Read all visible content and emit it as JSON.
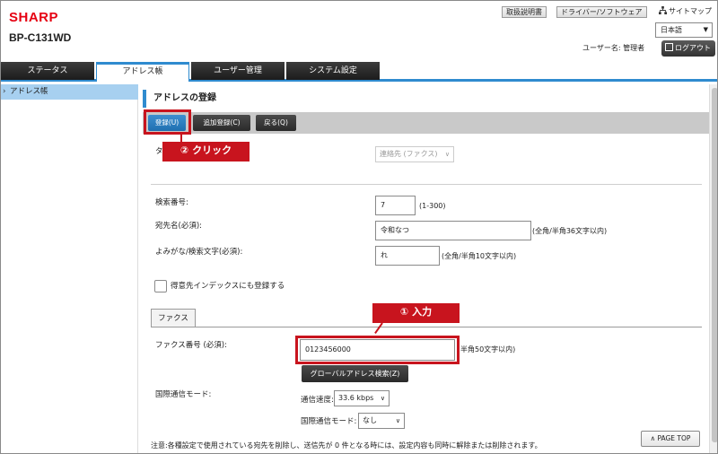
{
  "brand": "SHARP",
  "model": "BP-C131WD",
  "top_links": {
    "manual": "取扱説明書",
    "driver": "ドライバー/ソフトウェア",
    "sitemap": "サイトマップ"
  },
  "language": "日本語",
  "user": {
    "label": "ユーザー名: 管理者",
    "logout": "ログアウト"
  },
  "tabs": [
    "ステータス",
    "アドレス帳",
    "ユーザー管理",
    "システム設定"
  ],
  "active_tab": "アドレス帳",
  "sidebar": {
    "items": [
      {
        "label": "アドレス帳"
      }
    ]
  },
  "page_title": "アドレスの登録",
  "buttons": {
    "register": "登録(U)",
    "add_register": "追加登録(C)",
    "back": "戻る(Q)"
  },
  "callouts": {
    "click": "② クリック",
    "input": "① 入力"
  },
  "type": {
    "label": "タ",
    "value": "連絡先 (ファクス)"
  },
  "form": {
    "search_no": {
      "label": "検索番号:",
      "value": "7",
      "hint": "(1-300)"
    },
    "name": {
      "label": "宛先名(必須):",
      "value": "令和なつ",
      "hint": "(全角/半角36文字以内)"
    },
    "kana": {
      "label": "よみがな/検索文字(必須):",
      "value": "れ",
      "hint": "(全角/半角10文字以内)"
    },
    "index_checkbox": {
      "label": "得意先インデックスにも登録する",
      "checked": false
    }
  },
  "fax_tab": "ファクス",
  "fax": {
    "number": {
      "label": "ファクス番号 (必須):",
      "value": "0123456000",
      "hint": "半角50文字以内)"
    },
    "global_button": "グローバルアドレス検索(Z)",
    "intl_mode_label": "国際通信モード:",
    "speed": {
      "label": "通信速度:",
      "value": "33.6 kbps"
    },
    "intl": {
      "label": "国際通信モード:",
      "value": "なし"
    }
  },
  "note": "注意:各種設定で使用されている宛先を削除し、送信先が 0 件となる時には、設定内容も同時に解除または削除されます。",
  "page_top": "PAGE TOP",
  "colors": {
    "accent": "#2f8bcf",
    "highlight": "#c8141e",
    "brand": "#e60012"
  }
}
